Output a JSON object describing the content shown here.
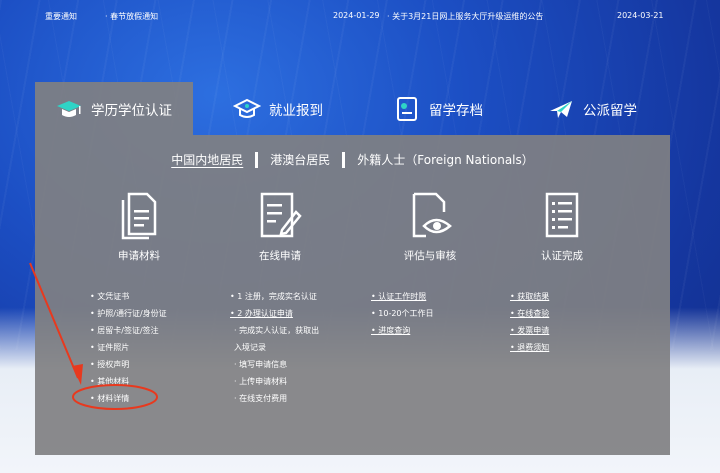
{
  "notice_bar": {
    "label": "重要通知",
    "item1_title": "· 春节放假通知",
    "item1_date": "2024-01-29",
    "item2_title": "· 关于3月21日网上服务大厅升级运维的公告",
    "item2_date": "2024-03-21"
  },
  "tabs": [
    {
      "label": "学历学位认证"
    },
    {
      "label": "就业报到"
    },
    {
      "label": "留学存档"
    },
    {
      "label": "公派留学"
    }
  ],
  "regions": {
    "r1": "中国内地居民",
    "r2": "港澳台居民",
    "r3": "外籍人士（Foreign Nationals）"
  },
  "steps": [
    {
      "label": "申请材料"
    },
    {
      "label": "在线申请"
    },
    {
      "label": "评估与审核"
    },
    {
      "label": "认证完成"
    }
  ],
  "columns": {
    "materials": [
      "• 文凭证书",
      "• 护照/通行证/身份证",
      "• 居留卡/签证/签注",
      "• 证件照片",
      "• 授权声明",
      "• 其他材料",
      "• 材料详情"
    ],
    "apply": [
      "• 1 注册，完成实名认证",
      "• 2 办理认证申请",
      "· 完成实人认证，获取出",
      "入境记录",
      "· 填写申请信息",
      "· 上传申请材料",
      "· 在线支付费用"
    ],
    "review": [
      "• 认证工作时限",
      "• 10-20个工作日",
      "• 进度查询"
    ],
    "complete": [
      "• 获取结果",
      "• 在线查验",
      "• 发票申请",
      "• 退费须知"
    ]
  },
  "colors": {
    "panel": "#808082",
    "annotation": "#e8391e",
    "background_blue": "#1c4fc4"
  }
}
